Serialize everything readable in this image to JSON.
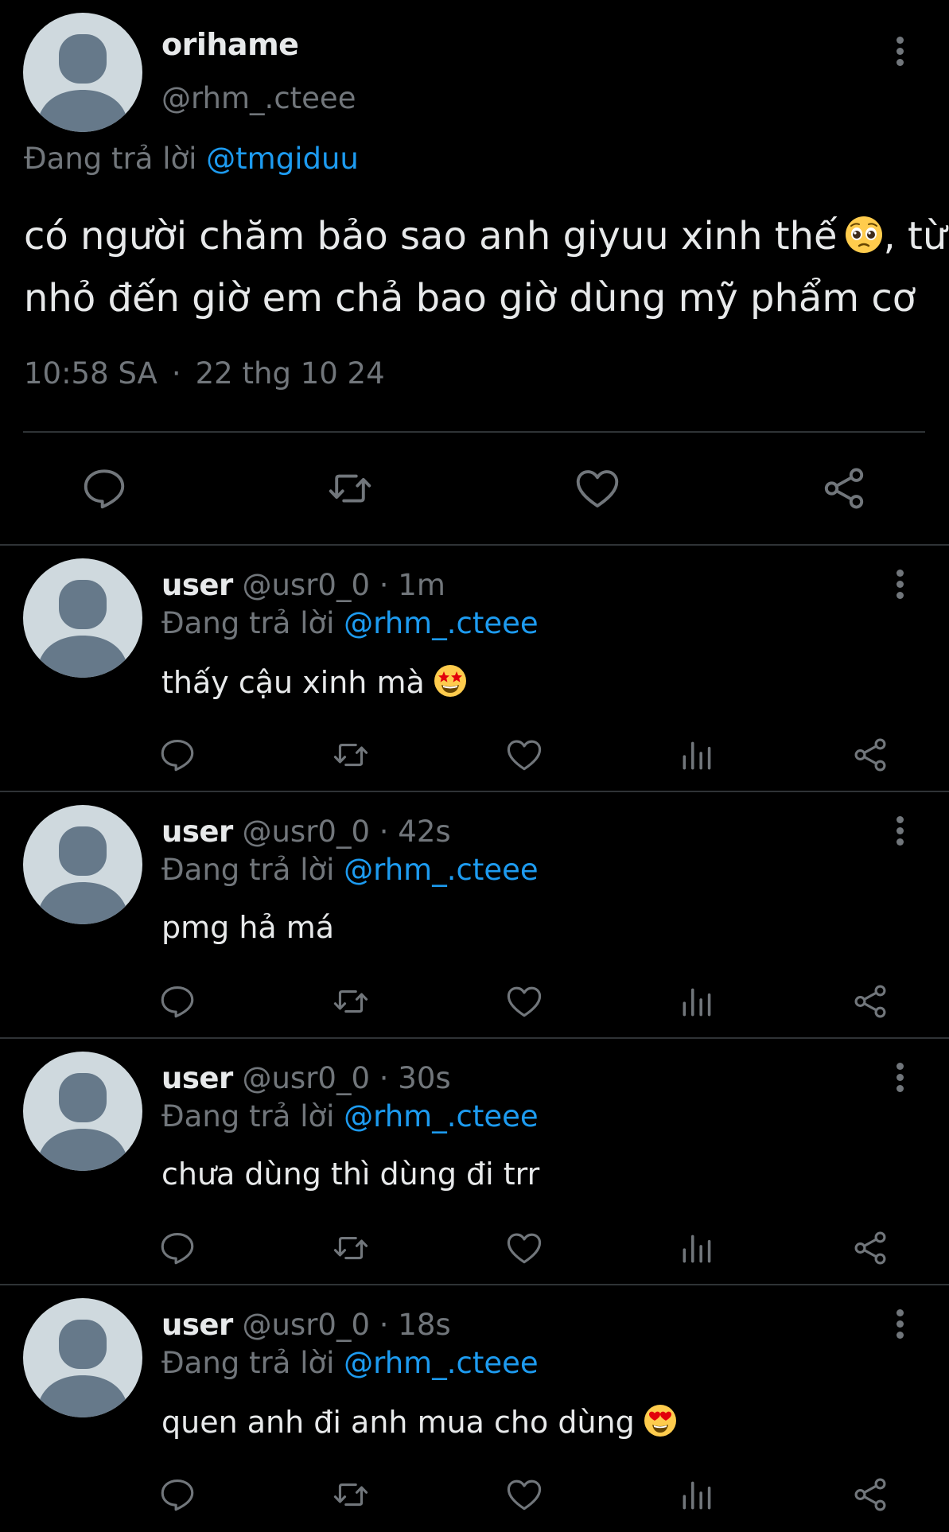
{
  "main_tweet": {
    "author_name": "orihame",
    "author_handle": "@rhm_.cteee",
    "replying_prefix": "Đang trả lời ",
    "replying_to": "@tmgiduu",
    "body_line1_text": "có người chăm bảo sao anh giyuu xinh thế",
    "body_line1_emoji": "pleading-face-emoji",
    "body_line1_after": ", từ",
    "body_line2": "nhỏ đến giờ em chả bao giờ dùng mỹ phẩm cơ",
    "time": "10:58 SA",
    "separator": "·",
    "date": "22 thg 10 24",
    "actions": [
      "reply-icon",
      "retweet-icon",
      "like-icon",
      "share-icon"
    ]
  },
  "replies": [
    {
      "name": "user",
      "handle": "@usr0_0",
      "time": "· 1m",
      "replying_prefix": "Đang trả lời ",
      "replying_to": "@rhm_.cteee",
      "text": "thấy cậu xinh mà",
      "emoji": "star-struck-emoji"
    },
    {
      "name": "user",
      "handle": "@usr0_0",
      "time": "· 42s",
      "replying_prefix": "Đang trả lời ",
      "replying_to": "@rhm_.cteee",
      "text": "pmg hả má",
      "emoji": ""
    },
    {
      "name": "user",
      "handle": "@usr0_0",
      "time": "· 30s",
      "replying_prefix": "Đang trả lời ",
      "replying_to": "@rhm_.cteee",
      "text": "chưa dùng thì dùng đi trr",
      "emoji": ""
    },
    {
      "name": "user",
      "handle": "@usr0_0",
      "time": "· 18s",
      "replying_prefix": "Đang trả lời ",
      "replying_to": "@rhm_.cteee",
      "text": "quen anh đi anh mua cho dùng",
      "emoji": "heart-eyes-emoji"
    }
  ],
  "reply_actions": [
    "reply-icon",
    "retweet-icon",
    "like-icon",
    "views-icon",
    "share-icon"
  ],
  "colors": {
    "background": "#000000",
    "text": "#e7e9ea",
    "secondary": "#71767b",
    "link": "#1d9bf0",
    "divider": "#2f3336",
    "avatar_bg": "#cfd9de",
    "avatar_fg": "#66798a"
  }
}
